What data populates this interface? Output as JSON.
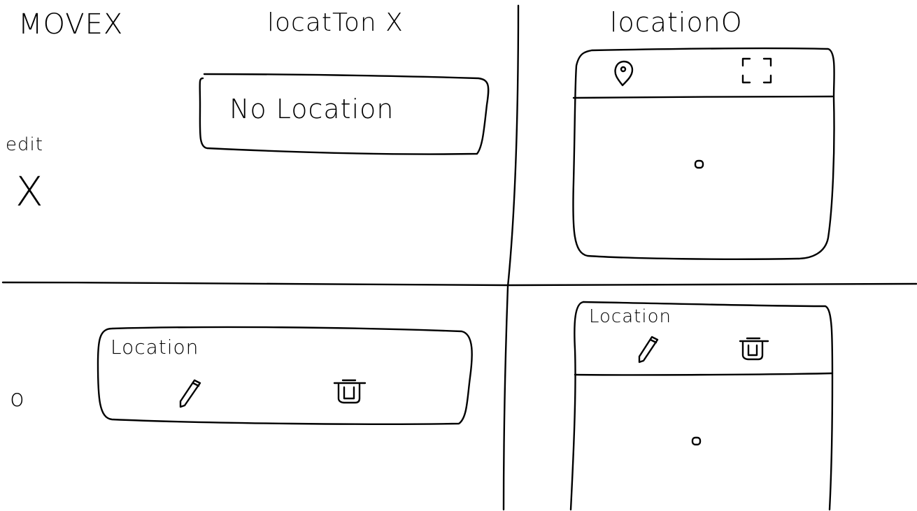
{
  "labels": {
    "move_x": "MOVEX",
    "location_x": "locatTon X",
    "location_o": "locationO",
    "edit": "edit",
    "x_mark": "X",
    "o_mark": "o"
  },
  "panels": {
    "no_location": {
      "text": "No Location"
    },
    "location_o_map": {
      "header_icons": [
        "map-pin-icon",
        "fullscreen-icon"
      ],
      "marker_icon": "map-marker-icon"
    },
    "edit_location": {
      "title": "Location",
      "icons": [
        "pencil-icon",
        "trash-icon"
      ]
    },
    "edit_location_map": {
      "title": "Location",
      "icons": [
        "pencil-icon",
        "trash-icon"
      ],
      "marker_icon": "map-marker-icon"
    }
  }
}
